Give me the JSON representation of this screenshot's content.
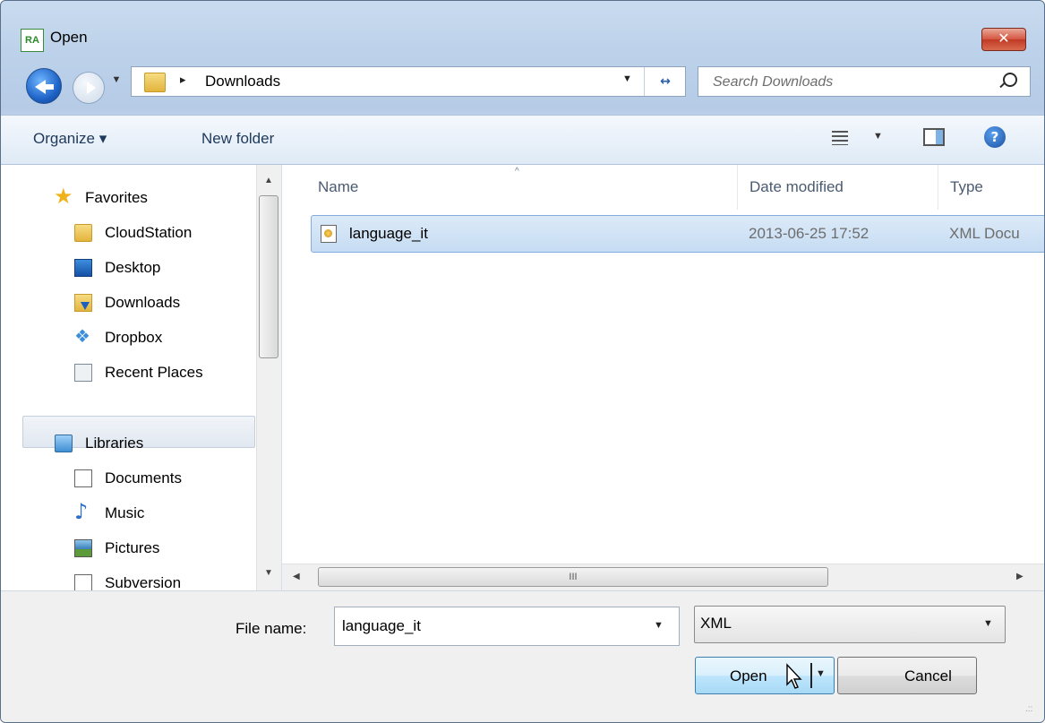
{
  "window": {
    "title": "Open",
    "app_icon_text": "RA",
    "close_glyph": "✕"
  },
  "nav": {
    "back_label": "",
    "history_drop": "▼",
    "address_folder": "Downloads",
    "crumb_sep": "▸",
    "address_drop": "▼",
    "refresh_glyph": "↔"
  },
  "search": {
    "placeholder": "Search Downloads"
  },
  "toolbar": {
    "organize": "Organize ▾",
    "new_folder": "New folder",
    "view_drop": "▼",
    "help": "?"
  },
  "sidebar": {
    "items": [
      {
        "label": "Favorites",
        "icon": "star-icon"
      },
      {
        "label": "CloudStation",
        "icon": "folder-icon"
      },
      {
        "label": "Desktop",
        "icon": "desktop-icon"
      },
      {
        "label": "Downloads",
        "icon": "downloads-icon"
      },
      {
        "label": "Dropbox",
        "icon": "dropbox-icon"
      },
      {
        "label": "Recent Places",
        "icon": "recent-places-icon"
      },
      {
        "label": "Libraries",
        "icon": "libraries-icon"
      },
      {
        "label": "Documents",
        "icon": "documents-icon"
      },
      {
        "label": "Music",
        "icon": "music-icon"
      },
      {
        "label": "Pictures",
        "icon": "pictures-icon"
      },
      {
        "label": "Subversion",
        "icon": "subversion-icon"
      }
    ],
    "scroll_up": "▲",
    "scroll_down": "▼"
  },
  "file_list": {
    "columns": [
      "Name",
      "Date modified",
      "Type"
    ],
    "sort_glyph": "^",
    "rows": [
      {
        "name": "language_it",
        "date": "2013-06-25 17:52",
        "type": "XML Docu"
      }
    ],
    "hscroll_left": "◀",
    "hscroll_right": "▶",
    "hscroll_grip": "III"
  },
  "footer": {
    "file_name_label": "File name:",
    "file_name_value": "language_it",
    "file_drop": "▼",
    "file_type": "XML",
    "type_drop": "▼",
    "open_label": "Open",
    "open_drop": "▼",
    "cancel_label": "Cancel",
    "grip": ".::"
  }
}
